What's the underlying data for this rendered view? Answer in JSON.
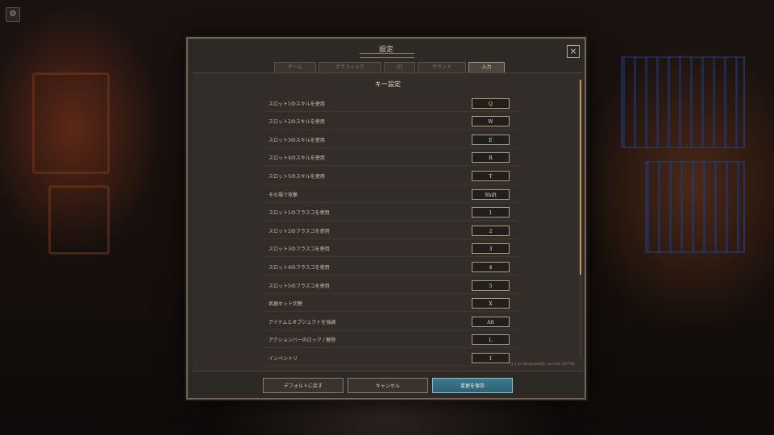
{
  "dialog": {
    "title": "設定",
    "close_label": "×",
    "tabs": [
      {
        "label": "ゲーム",
        "active": false
      },
      {
        "label": "グラフィック",
        "active": false
      },
      {
        "label": "UI",
        "active": false
      },
      {
        "label": "サウンド",
        "active": false
      },
      {
        "label": "入力",
        "active": true
      }
    ],
    "section_title": "キー設定",
    "bindings": [
      {
        "label": "スロット1のスキルを使用",
        "key": "Q"
      },
      {
        "label": "スロット2のスキルを使用",
        "key": "W"
      },
      {
        "label": "スロット3のスキルを使用",
        "key": "E"
      },
      {
        "label": "スロット4のスキルを使用",
        "key": "R"
      },
      {
        "label": "スロット5のスキルを使用",
        "key": "T"
      },
      {
        "label": "その場で攻撃",
        "key": "Shift"
      },
      {
        "label": "スロット1のフラスコを使用",
        "key": "1"
      },
      {
        "label": "スロット2のフラスコを使用",
        "key": "2"
      },
      {
        "label": "スロット3のフラスコを使用",
        "key": "3"
      },
      {
        "label": "スロット4のフラスコを使用",
        "key": "4"
      },
      {
        "label": "スロット5のフラスコを使用",
        "key": "5"
      },
      {
        "label": "武器セット切替",
        "key": "X"
      },
      {
        "label": "アイテムとオブジェクトを強調",
        "key": "Alt"
      },
      {
        "label": "アクションバーのロック / 解除",
        "key": "L"
      },
      {
        "label": "インベントリ",
        "key": "I"
      }
    ],
    "version": "0.1.0-/main/early_access.50744",
    "buttons": {
      "reset": "デフォルトに戻す",
      "cancel": "キャンセル",
      "save": "変更を保存"
    }
  },
  "colors": {
    "accent": "#c99a55",
    "primary_button": "#2e6274"
  },
  "icons": {
    "corner": "gear-icon",
    "close": "close-icon"
  }
}
